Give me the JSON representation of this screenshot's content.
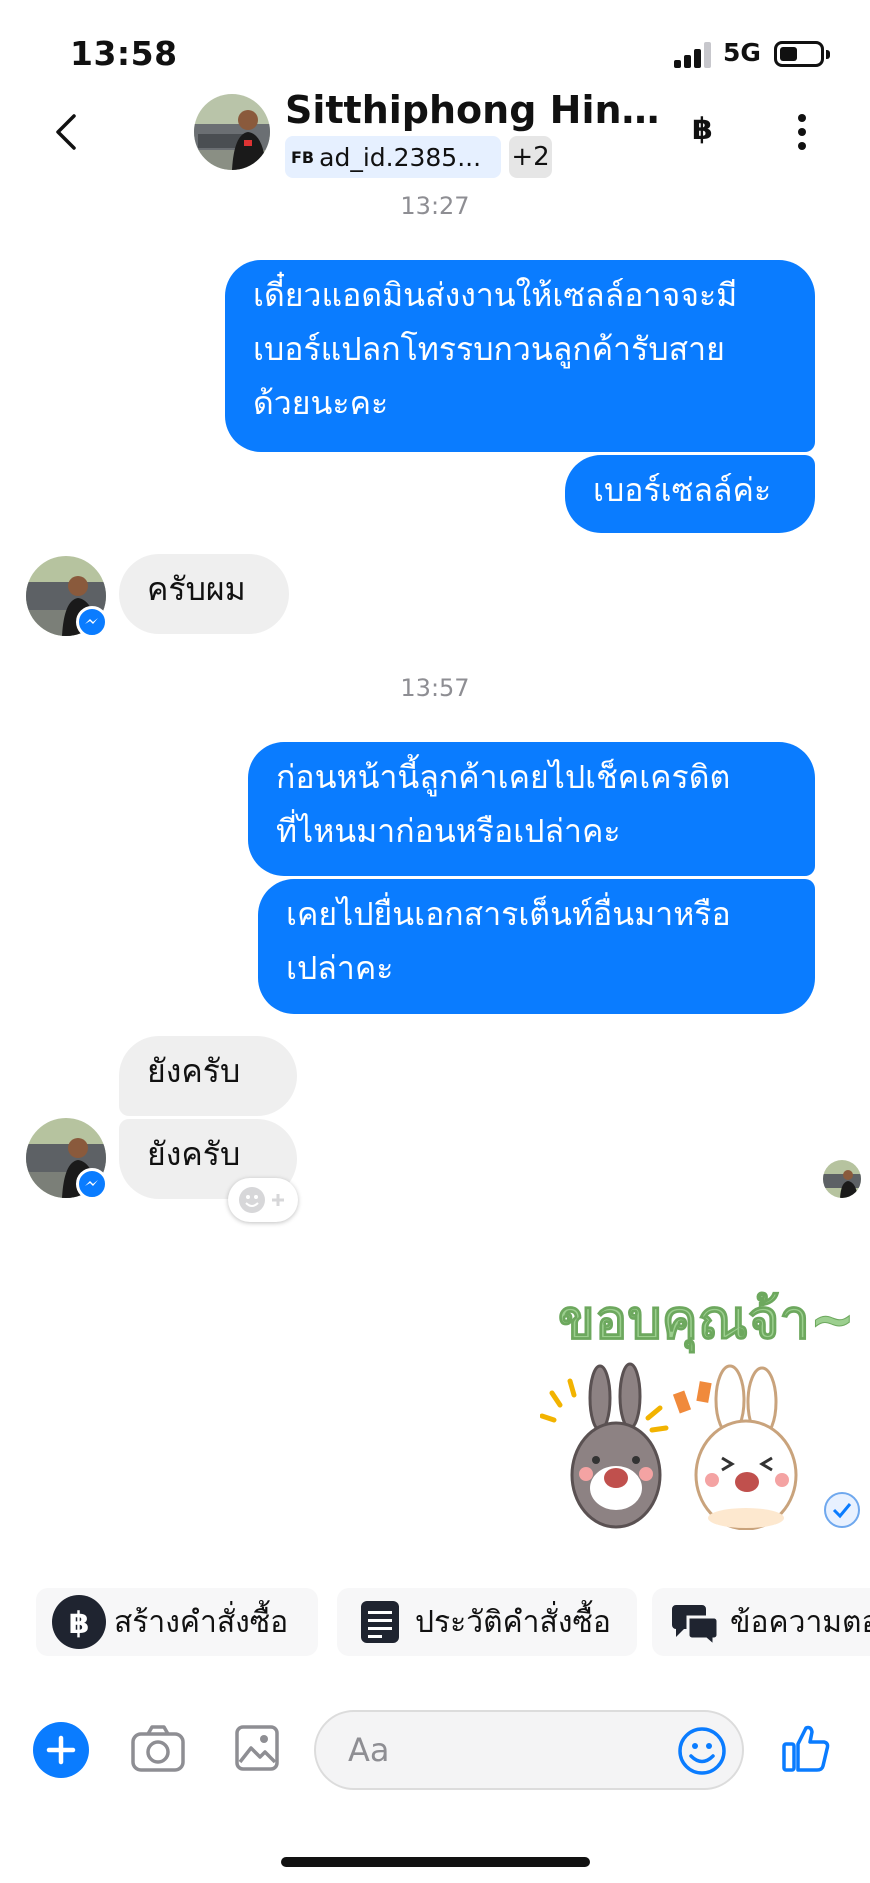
{
  "status_bar": {
    "time": "13:58",
    "network": "5G",
    "battery_level": 0.4
  },
  "header": {
    "contact_name": "Sitthiphong Hinhat...",
    "tag_prefix": "FB",
    "tag_text": "ad_id.2385...",
    "extra_tags": "+2",
    "baht_symbol": "฿"
  },
  "timestamps": [
    "13:27",
    "13:57"
  ],
  "messages": {
    "out_1_line1": "เดี๋ยวแอดมินส่งงานให้เซลล์อาจจะมี",
    "out_1_line2": "เบอร์แปลกโทรรบกวนลูกค้ารับสาย",
    "out_1_line3": "ด้วยนะคะ",
    "out_2": "เบอร์เซลล์ค่ะ",
    "in_1": "ครับผม",
    "out_3_line1": "ก่อนหน้านี้ลูกค้าเคยไปเช็คเครดิต",
    "out_3_line2": "ที่ไหนมาก่อนหรือเปล่าคะ",
    "out_4_line1": "เคยไปยื่นเอกสารเต็นท์อื่นมาหรือ",
    "out_4_line2": "เปล่าคะ",
    "in_2": "ยังครับ",
    "in_3": "ยังครับ"
  },
  "sticker": {
    "text": "ขอบคุณจ้า~"
  },
  "quick_actions": [
    {
      "label": "สร้างคำสั่งซื้อ",
      "icon": "baht-circle-icon"
    },
    {
      "label": "ประวัติคำสั่งซื้อ",
      "icon": "order-list-icon"
    },
    {
      "label": "ข้อความตอ",
      "icon": "chat-bubbles-icon"
    }
  ],
  "composer": {
    "placeholder": "Aa"
  },
  "colors": {
    "accent": "#0a7cff",
    "incoming_bubble": "#efefef",
    "timestamp": "#8e8e93"
  }
}
